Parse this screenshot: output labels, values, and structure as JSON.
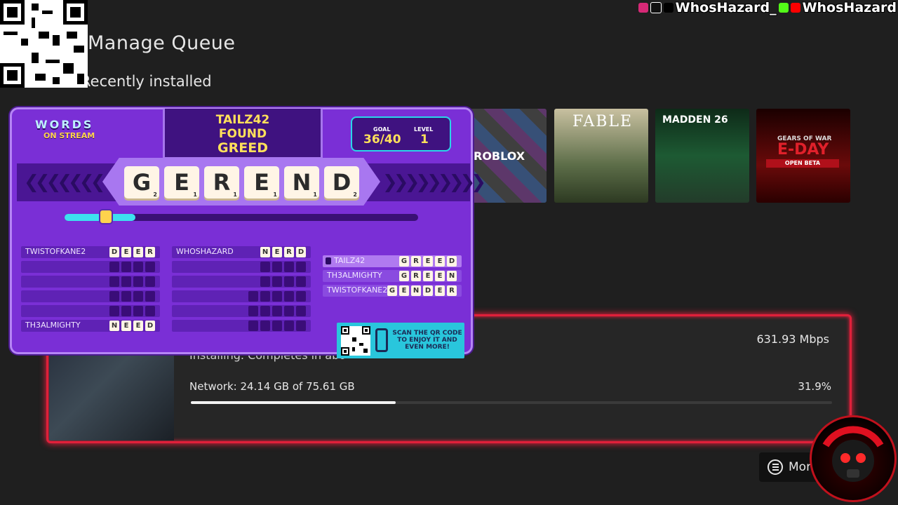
{
  "page": {
    "title": "Manage Queue",
    "section": "Recently installed"
  },
  "tiles": [
    {
      "name": "roblox",
      "label": "ROBLOX",
      "color": "#2a2a2a"
    },
    {
      "name": "fable",
      "label": "FABLE",
      "color": "#6d7a5a"
    },
    {
      "name": "madden",
      "label": "MADDEN 26",
      "color": "#1d5a33"
    },
    {
      "name": "gears",
      "label": "E-DAY",
      "sub": "OPEN BETA",
      "top": "GEARS OF WAR",
      "color": "#6a0a0a"
    }
  ],
  "queue": {
    "rate": "631.93 Mbps",
    "status": "Installing. Completes in abo",
    "network": "Network: 24.14 GB of 75.61 GB",
    "percent_label": "31.9%",
    "progress": 0.319
  },
  "more_button": {
    "label": "Mor"
  },
  "social": {
    "handle1": "WhosHazard_",
    "handle2": "WhosHazard"
  },
  "widget": {
    "logo_line1": "WORDS",
    "logo_line2": "ON STREAM",
    "announce": [
      "TAILZ42",
      "FOUND",
      "GREED"
    ],
    "goal_label": "GOAL",
    "goal_value": "36/40",
    "level_label": "LEVEL",
    "level_value": "1",
    "word_tiles": [
      {
        "letter": "G",
        "score": "2"
      },
      {
        "letter": "E",
        "score": "1"
      },
      {
        "letter": "R",
        "score": "1"
      },
      {
        "letter": "E",
        "score": "1"
      },
      {
        "letter": "N",
        "score": "1"
      },
      {
        "letter": "D",
        "score": "2"
      }
    ],
    "progress": 0.2,
    "players_left": [
      {
        "name": "TWISTOFKANE2",
        "word": [
          "D",
          "E",
          "E",
          "R"
        ]
      },
      {
        "name": "",
        "word": [
          "",
          "",
          "",
          ""
        ]
      },
      {
        "name": "",
        "word": [
          "",
          "",
          "",
          ""
        ]
      },
      {
        "name": "",
        "word": [
          "",
          "",
          "",
          ""
        ]
      },
      {
        "name": "",
        "word": [
          "",
          "",
          "",
          ""
        ]
      },
      {
        "name": "TH3ALMIGHTY",
        "word": [
          "N",
          "E",
          "E",
          "D"
        ]
      }
    ],
    "players_mid": [
      {
        "name": "WHOSHAZARD",
        "word": [
          "N",
          "E",
          "R",
          "D"
        ]
      },
      {
        "name": "",
        "word": [
          "",
          "",
          "",
          ""
        ]
      },
      {
        "name": "",
        "word": [
          "",
          "",
          "",
          ""
        ]
      },
      {
        "name": "",
        "word": [
          "",
          "",
          "",
          "",
          ""
        ]
      },
      {
        "name": "",
        "word": [
          "",
          "",
          "",
          "",
          ""
        ]
      },
      {
        "name": "",
        "word": [
          "",
          "",
          "",
          "",
          ""
        ]
      }
    ],
    "found_words": [
      {
        "name": "TAILZ42",
        "word": [
          "G",
          "R",
          "E",
          "E",
          "D"
        ]
      },
      {
        "name": "TH3ALMIGHTY",
        "word": [
          "G",
          "R",
          "E",
          "E",
          "N"
        ]
      },
      {
        "name": "TWISTOFKANE2",
        "word": [
          "G",
          "E",
          "N",
          "D",
          "E",
          "R"
        ]
      }
    ],
    "banner_text": "SCAN THE QR CODE TO ENJOY IT AND EVEN MORE!"
  }
}
